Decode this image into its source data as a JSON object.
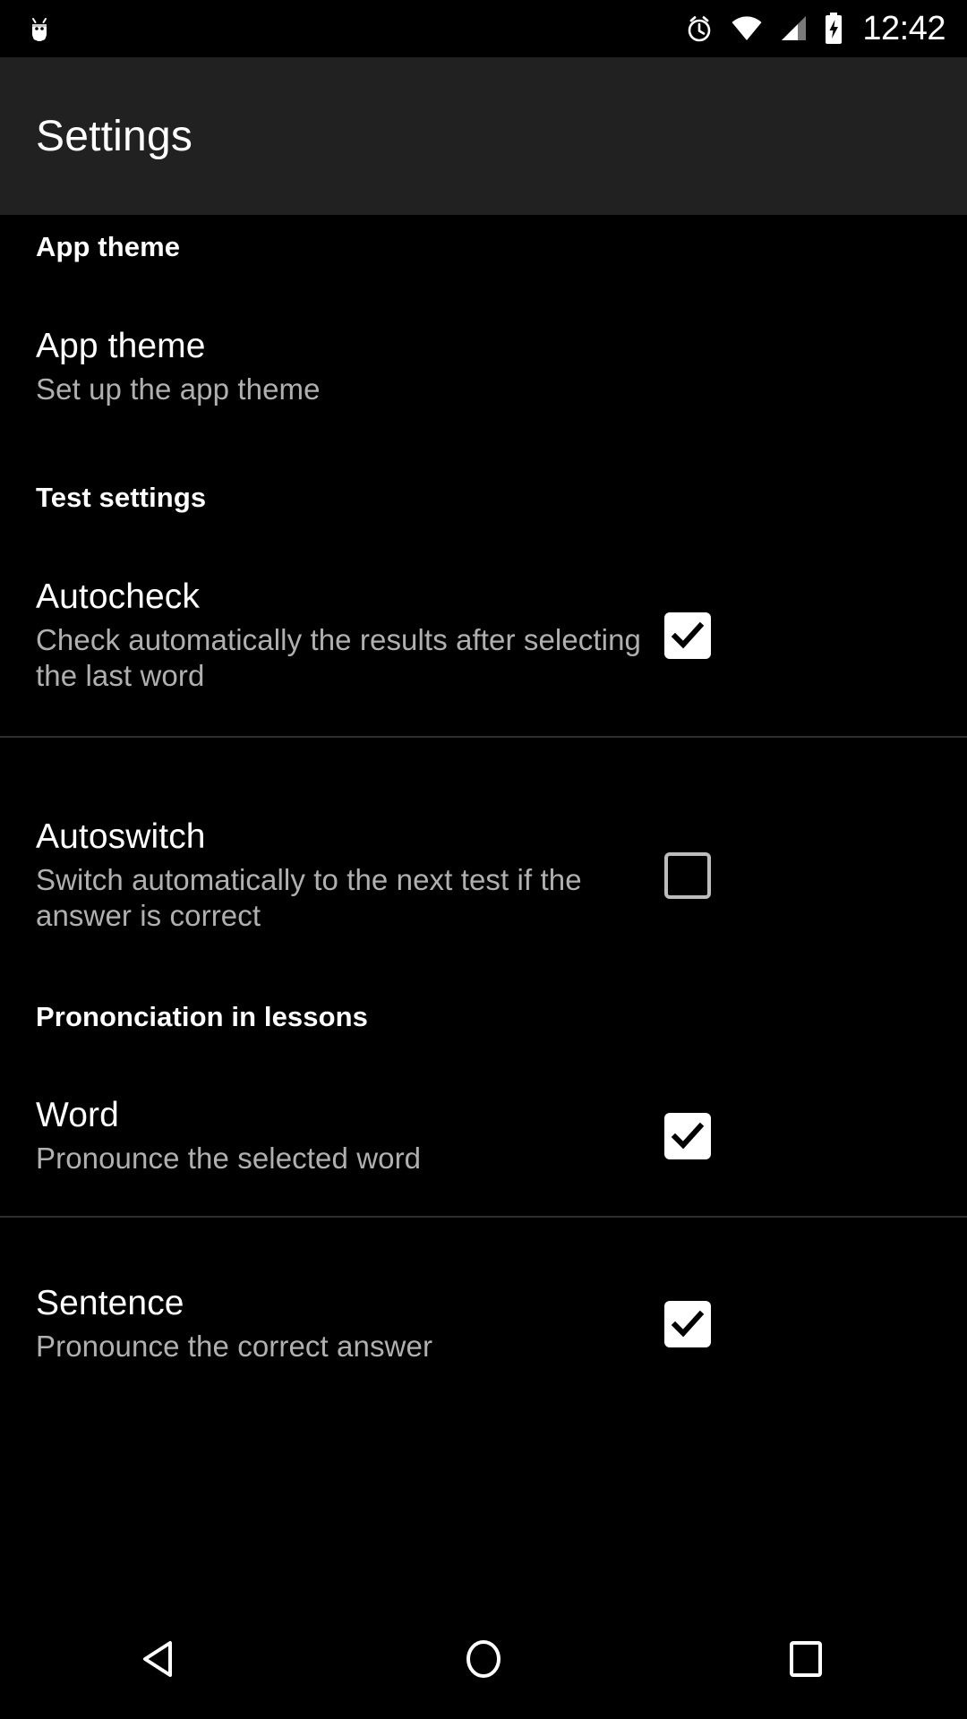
{
  "status_bar": {
    "app_icon": "android-droid-icon",
    "icons": [
      "alarm-clock-icon",
      "wifi-icon",
      "cellular-signal-icon",
      "battery-charging-icon"
    ],
    "clock": "12:42"
  },
  "app_bar": {
    "title": "Settings"
  },
  "sections": [
    {
      "header": "App theme",
      "items": [
        {
          "title": "App theme",
          "summary": "Set up the app theme",
          "has_checkbox": false,
          "checked": null
        }
      ]
    },
    {
      "header": "Test settings",
      "items": [
        {
          "title": "Autocheck",
          "summary": "Check automatically the results after selecting the last word",
          "has_checkbox": true,
          "checked": true
        },
        {
          "title": "Autoswitch",
          "summary": "Switch automatically to the next test if the answer is correct",
          "has_checkbox": true,
          "checked": false
        }
      ]
    },
    {
      "header": "Prononciation in lessons",
      "items": [
        {
          "title": "Word",
          "summary": "Pronounce the selected word",
          "has_checkbox": true,
          "checked": true
        },
        {
          "title": "Sentence",
          "summary": "Pronounce the correct answer",
          "has_checkbox": true,
          "checked": true
        }
      ]
    }
  ],
  "nav_bar": {
    "back": "back-triangle-icon",
    "home": "home-circle-icon",
    "recents": "recents-square-icon"
  },
  "colors": {
    "background": "#000000",
    "app_bar": "#212121",
    "title_text": "#ffffff",
    "summary_text": "#b0b0b0",
    "divider": "#2e2e2e",
    "checkbox_checked_fill": "#ffffff",
    "checkbox_unchecked_border": "#bdbdbd"
  }
}
